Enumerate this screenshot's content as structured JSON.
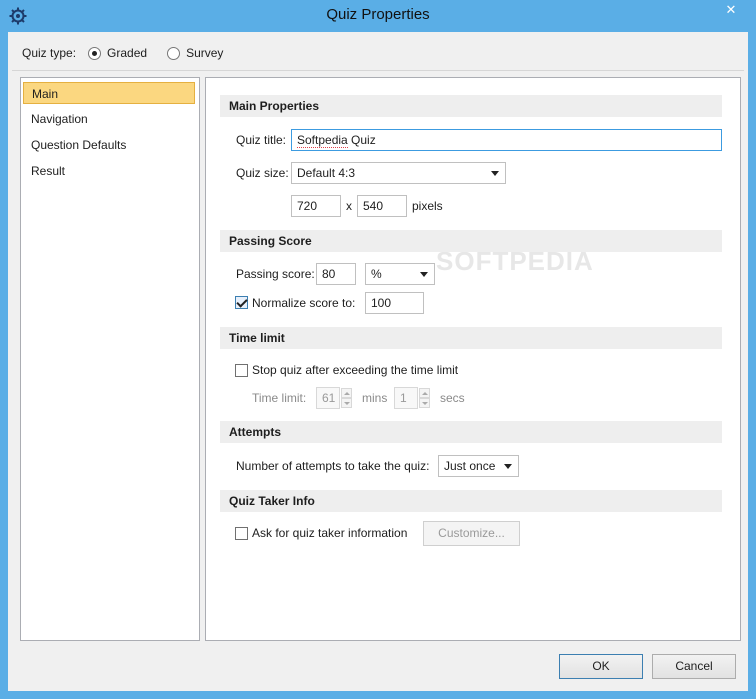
{
  "window": {
    "title": "Quiz Properties",
    "close_glyph": "✕",
    "icon": "gear-icon"
  },
  "quiz_type": {
    "label": "Quiz type:",
    "options": [
      {
        "label": "Graded",
        "selected": true
      },
      {
        "label": "Survey",
        "selected": false
      }
    ]
  },
  "nav": {
    "items": [
      {
        "label": "Main",
        "selected": true
      },
      {
        "label": "Navigation",
        "selected": false
      },
      {
        "label": "Question Defaults",
        "selected": false
      },
      {
        "label": "Result",
        "selected": false
      }
    ]
  },
  "main_properties": {
    "heading": "Main Properties",
    "quiz_title_label": "Quiz title:",
    "quiz_title_value_word1": "Softpedia",
    "quiz_title_value_word2": " Quiz",
    "quiz_size_label": "Quiz size:",
    "quiz_size_value": "Default 4:3",
    "width_value": "720",
    "x_label": "x",
    "height_value": "540",
    "pixels_label": "pixels"
  },
  "passing_score": {
    "heading": "Passing Score",
    "label": "Passing score:",
    "value": "80",
    "unit_value": "%",
    "normalize_label": "Normalize score to:",
    "normalize_checked": true,
    "normalize_value": "100"
  },
  "time_limit": {
    "heading": "Time limit",
    "stop_label": "Stop quiz after exceeding the time limit",
    "stop_checked": false,
    "limit_label": "Time limit:",
    "mins_value": "61",
    "mins_label": "mins",
    "secs_value": "1",
    "secs_label": "secs"
  },
  "attempts": {
    "heading": "Attempts",
    "label": "Number of attempts to take the quiz:",
    "value": "Just once"
  },
  "quiz_taker_info": {
    "heading": "Quiz Taker Info",
    "ask_label": "Ask for quiz taker information",
    "ask_checked": false,
    "customize_label": "Customize..."
  },
  "footer": {
    "ok_label": "OK",
    "cancel_label": "Cancel"
  },
  "watermark": "SOFTPEDIA"
}
